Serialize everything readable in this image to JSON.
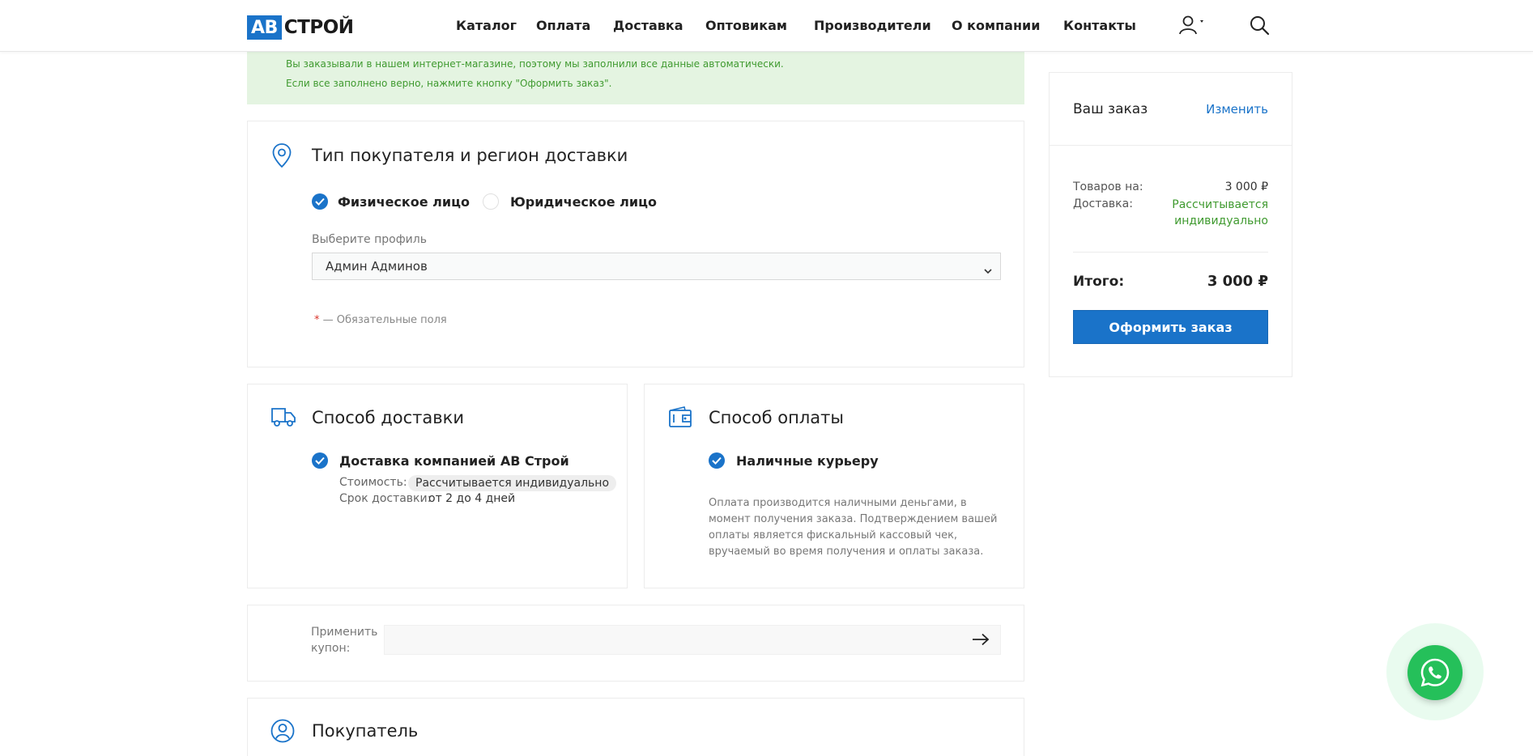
{
  "header": {
    "logo": {
      "ab": "АВ",
      "rest": "СТРОЙ"
    },
    "nav": [
      {
        "label": "Каталог"
      },
      {
        "label": "Оплата"
      },
      {
        "label": "Доставка"
      },
      {
        "label": "Оптовикам"
      },
      {
        "label": "Производители"
      },
      {
        "label": "О компании"
      },
      {
        "label": "Контакты"
      }
    ],
    "icons": {
      "user": "user-icon",
      "search": "search-icon"
    }
  },
  "notice": {
    "line1": "Вы заказывали в нашем интернет-магазине, поэтому мы заполнили все данные автоматически.",
    "line2": "Если все заполнено верно, нажмите кнопку \"Оформить заказ\"."
  },
  "buyer_type": {
    "title": "Тип покупателя и регион доставки",
    "options": [
      {
        "label": "Физическое лицо",
        "checked": true
      },
      {
        "label": "Юридическое лицо",
        "checked": false
      }
    ],
    "profile_label": "Выберите профиль",
    "profile_value": "Админ Админов",
    "required_star": "*",
    "required_note": " — Обязательные поля"
  },
  "delivery": {
    "title": "Способ доставки",
    "option": "Доставка компанией АВ Строй",
    "cost_label": "Стоимость:",
    "cost_value": "Рассчитывается индивидуально",
    "term_label": "Срок доставки:",
    "term_value": "от 2 до 4 дней"
  },
  "payment": {
    "title": "Способ оплаты",
    "option": "Наличные курьеру",
    "description": "Оплата производится наличными деньгами, в момент получения заказа. Подтверждением вашей оплаты является фискальный кассовый чек, вручаемый во время получения и оплаты заказа."
  },
  "coupon": {
    "label_line1": "Применить",
    "label_line2": "купон:",
    "value": ""
  },
  "customer": {
    "title": "Покупатель"
  },
  "order": {
    "title": "Ваш заказ",
    "edit": "Изменить",
    "goods_label": "Товаров на:",
    "goods_value": "3 000 ₽",
    "delivery_label": "Доставка:",
    "delivery_value_line1": "Рассчитывается",
    "delivery_value_line2": "индивидуально",
    "total_label": "Итого:",
    "total_value": "3 000 ₽",
    "submit": "Оформить заказ"
  },
  "colors": {
    "accent": "#1a73c9",
    "success_bg": "#e4f4e1",
    "success_text": "#3f9a2f",
    "whatsapp": "#25c05a"
  },
  "whatsapp": {
    "icon": "whatsapp-icon"
  }
}
